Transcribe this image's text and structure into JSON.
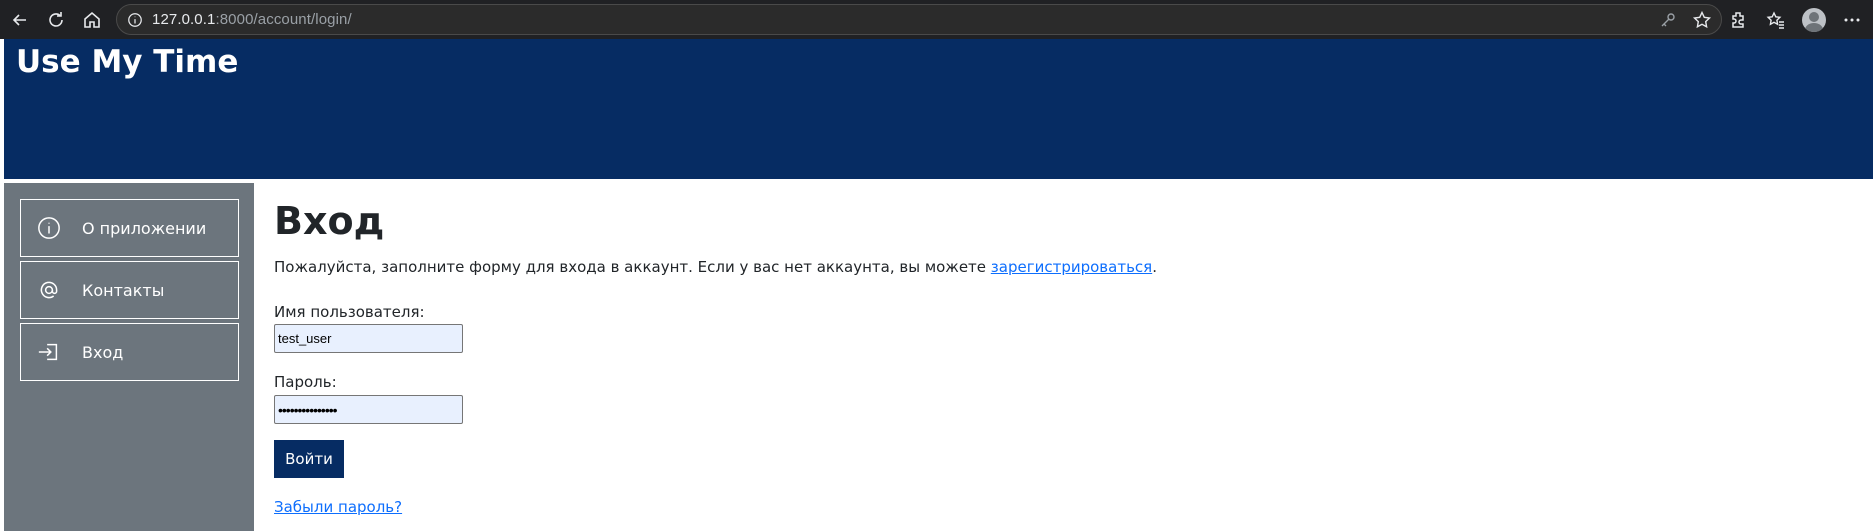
{
  "browser": {
    "url_host": "127.0.0.1",
    "url_rest": ":8000/account/login/"
  },
  "site": {
    "title": "Use My Time",
    "header_color": "#062c63",
    "sidebar_color": "#6c757d"
  },
  "sidebar": {
    "items": [
      {
        "label": "О приложении",
        "icon": "info-icon"
      },
      {
        "label": "Контакты",
        "icon": "at-icon"
      },
      {
        "label": "Вход",
        "icon": "login-icon"
      }
    ]
  },
  "main": {
    "heading": "Вход",
    "intro_text": "Пожалуйста, заполните форму для входа в аккаунт. Если у вас нет аккаунта, вы можете ",
    "register_link": "зарегистрироваться",
    "intro_end": ".",
    "username_label": "Имя пользователя:",
    "username_value": "test_user",
    "password_label": "Пароль:",
    "password_value": "•••••••••••••••",
    "submit_label": "Войти",
    "forgot_link": "Забыли пароль?"
  }
}
